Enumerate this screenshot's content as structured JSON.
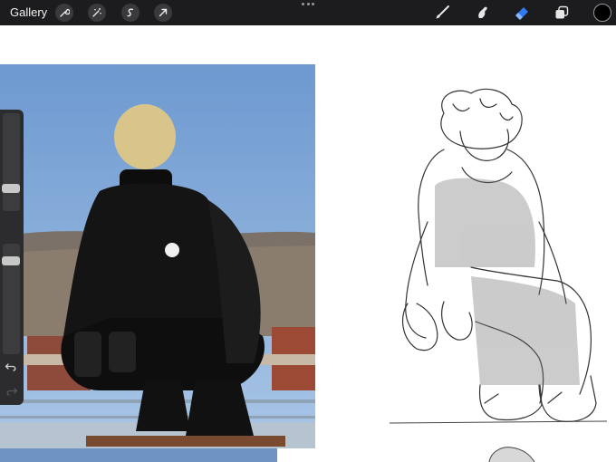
{
  "toolbar": {
    "gallery_label": "Gallery",
    "left_tools": [
      "wrench-icon",
      "magic-wand-icon",
      "selection-icon",
      "transform-arrow-icon"
    ],
    "right_tools": [
      "brush-icon",
      "smudge-icon",
      "eraser-icon",
      "layers-icon"
    ],
    "current_color": "#000000",
    "accent_color": "#2f7bf6"
  },
  "sidebar": {
    "size_slider": 0.55,
    "opacity_slider": 0.3,
    "controls": [
      "modify-square-icon",
      "undo-icon",
      "redo-icon"
    ]
  }
}
